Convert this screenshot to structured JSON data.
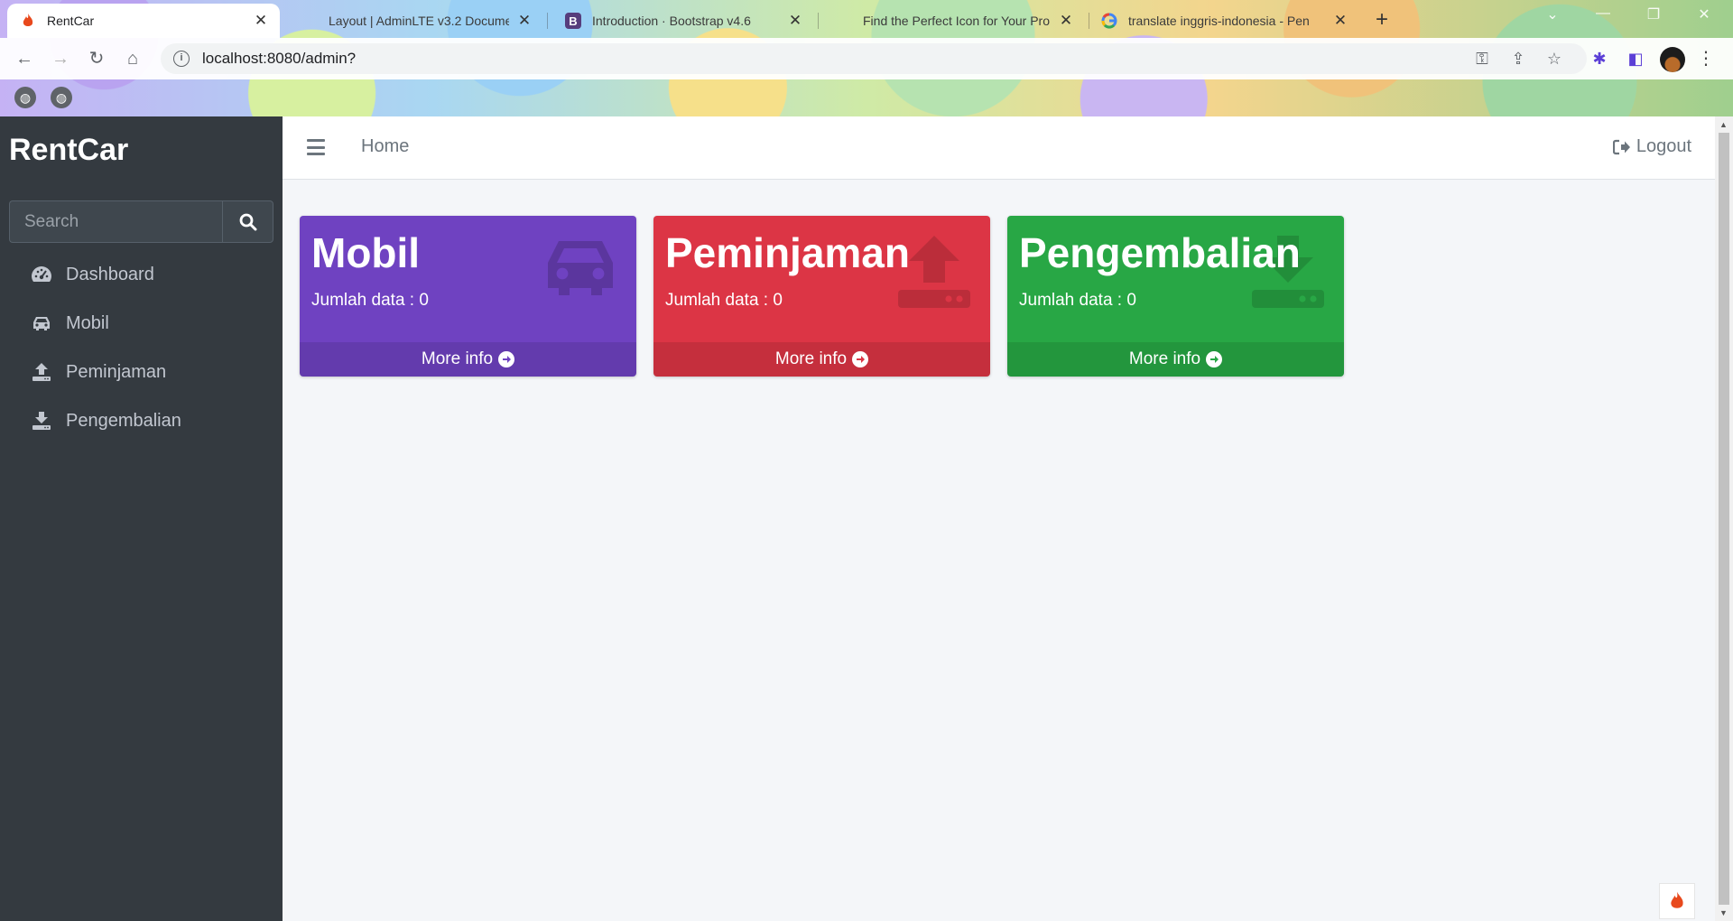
{
  "browser": {
    "tabs": [
      {
        "title": "RentCar",
        "active": true
      },
      {
        "title": "Layout | AdminLTE v3.2 Docume",
        "active": false
      },
      {
        "title": "Introduction · Bootstrap v4.6",
        "active": false
      },
      {
        "title": "Find the Perfect Icon for Your Pro",
        "active": false
      },
      {
        "title": "translate inggris-indonesia - Pen",
        "active": false
      }
    ],
    "url": "localhost:8080/admin?"
  },
  "sidebar": {
    "brand": "RentCar",
    "search_placeholder": "Search",
    "items": [
      {
        "label": "Dashboard",
        "icon": "tachometer-icon"
      },
      {
        "label": "Mobil",
        "icon": "car-icon"
      },
      {
        "label": "Peminjaman",
        "icon": "upload-icon"
      },
      {
        "label": "Pengembalian",
        "icon": "download-icon"
      }
    ]
  },
  "topbar": {
    "home_label": "Home",
    "logout_label": "Logout"
  },
  "cards": [
    {
      "title": "Mobil",
      "subtitle": "Jumlah data : 0",
      "footer": "More info",
      "color": "#6f42c1",
      "icon": "car-icon"
    },
    {
      "title": "Peminjaman",
      "subtitle": "Jumlah data : 0",
      "footer": "More info",
      "color": "#dc3545",
      "icon": "upload-icon"
    },
    {
      "title": "Pengembalian",
      "subtitle": "Jumlah data : 0",
      "footer": "More info",
      "color": "#28a745",
      "icon": "download-icon"
    }
  ],
  "colors": {
    "sidebar_bg": "#343a40",
    "content_bg": "#f4f6f9"
  }
}
